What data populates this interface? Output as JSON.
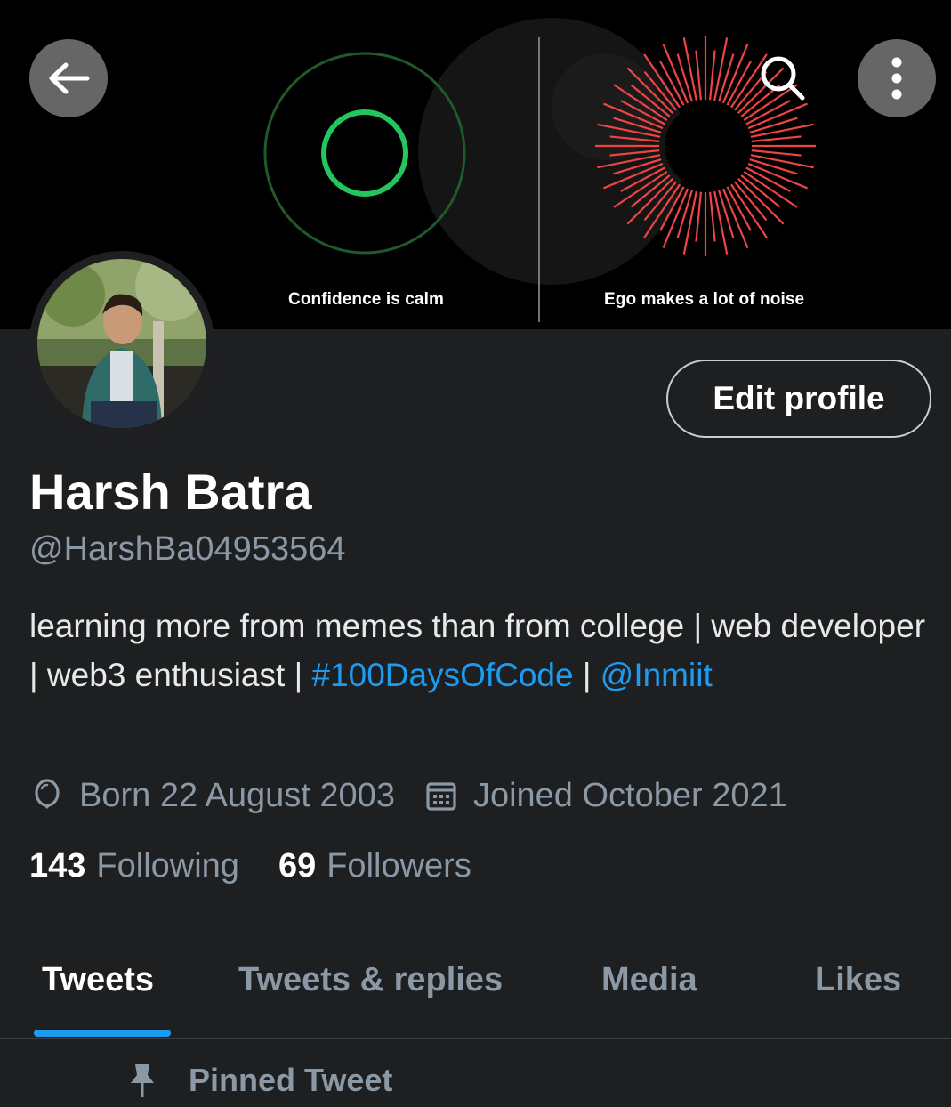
{
  "banner": {
    "caption_left": "Confidence is calm",
    "caption_right": "Ego makes a lot of noise",
    "colors": {
      "calm": "#22c55e",
      "noise": "#ef4444"
    }
  },
  "header": {
    "back_icon": "arrow-left-icon",
    "search_icon": "search-icon",
    "more_icon": "more-vertical-icon"
  },
  "profile": {
    "edit_label": "Edit profile",
    "name": "Harsh Batra",
    "handle": "@HarshBa04953564",
    "bio_text_1": "learning more from memes than from college | web developer | web3 enthusiast | ",
    "bio_hashtag": "#100DaysOfCode",
    "bio_sep": " | ",
    "bio_mention": "@Inmiit",
    "born": "Born 22 August 2003",
    "joined": "Joined October 2021",
    "following_count": "143",
    "following_label": "Following",
    "followers_count": "69",
    "followers_label": "Followers",
    "accent": "#1d9bf0"
  },
  "tabs": [
    {
      "label": "Tweets",
      "active": true
    },
    {
      "label": "Tweets & replies",
      "active": false
    },
    {
      "label": "Media",
      "active": false
    },
    {
      "label": "Likes",
      "active": false
    }
  ],
  "pinned": {
    "label": "Pinned Tweet",
    "icon": "pin-icon"
  }
}
